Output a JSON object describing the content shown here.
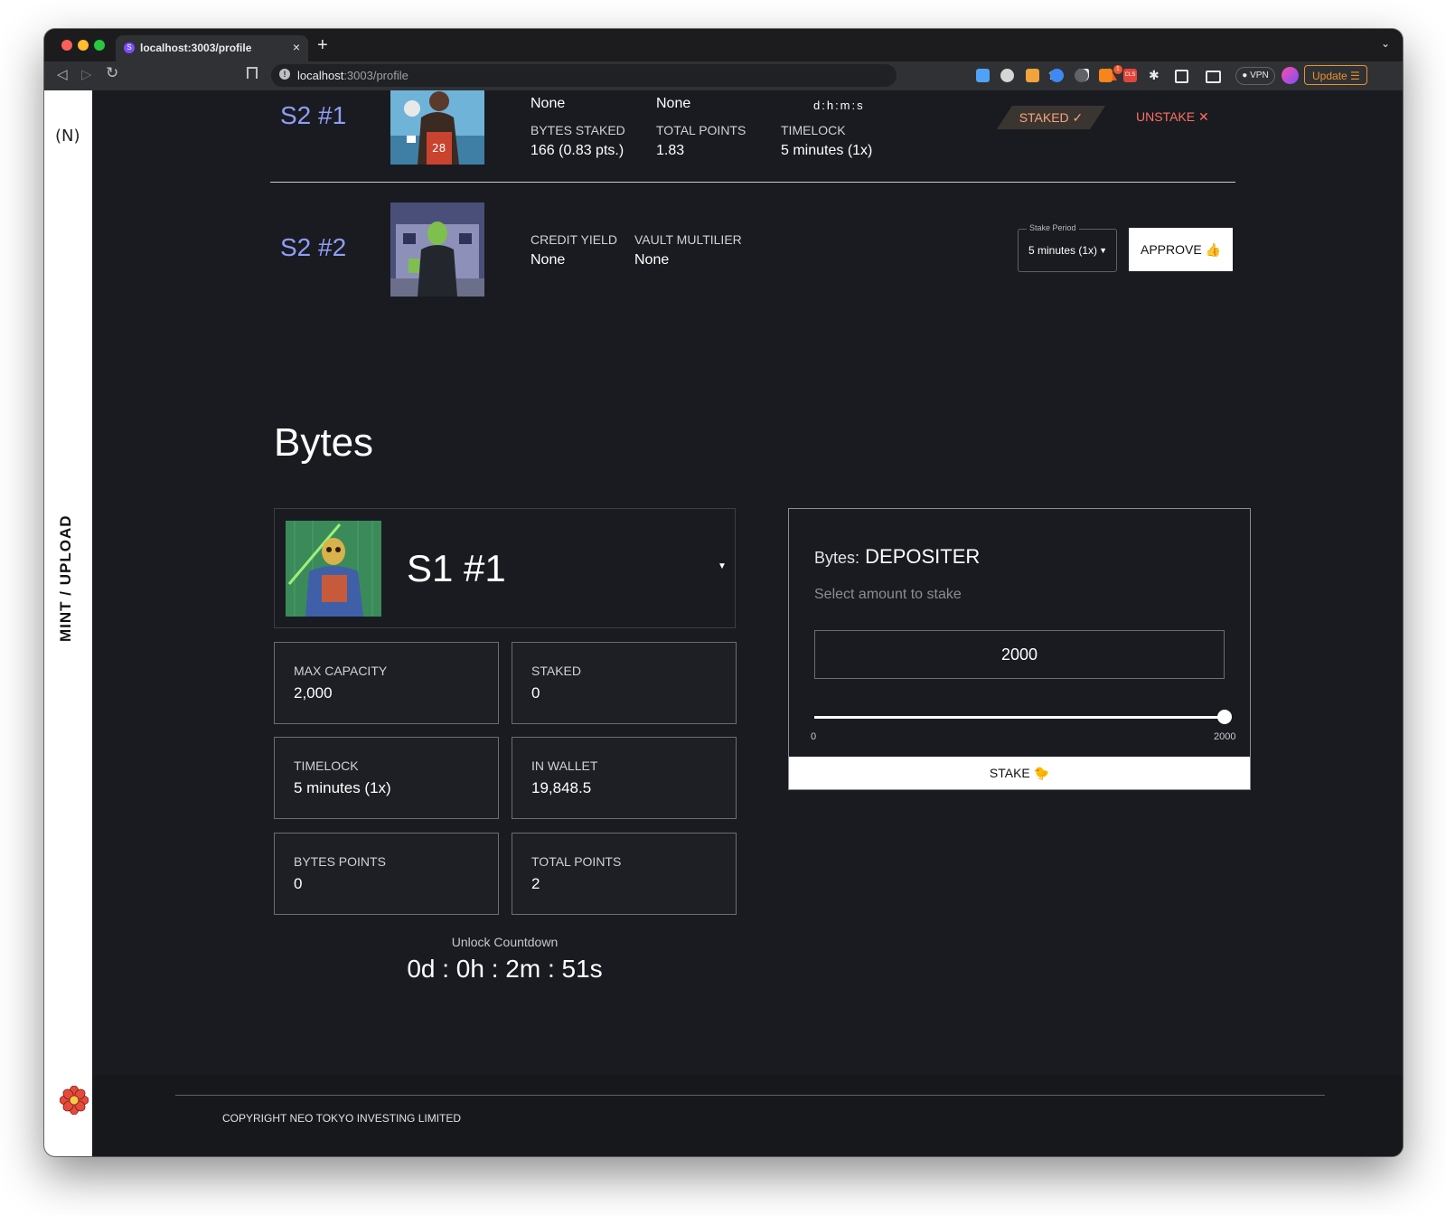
{
  "browser": {
    "tab_title": "localhost:3003/profile",
    "tab_close": "×",
    "new_tab": "+",
    "url_host": "localhost",
    "url_path": ":3003/profile",
    "vpn_label": "● VPN",
    "update_label": "Update ☰",
    "rewards_count": "1"
  },
  "sidebar": {
    "logo": "(N)",
    "mint_label": "MINT / UPLOAD"
  },
  "citizens": [
    {
      "name": "S2 #1",
      "top_values": [
        "None",
        "None"
      ],
      "countdown_format": "d:h:m:s",
      "labels": [
        "BYTES STAKED",
        "TOTAL POINTS",
        "TIMELOCK"
      ],
      "values": [
        "166 (0.83 pts.)",
        "1.83",
        "5 minutes (1x)"
      ],
      "status": "STAKED ✓",
      "unstake": "UNSTAKE ✕"
    },
    {
      "name": "S2 #2",
      "labels": [
        "CREDIT YIELD",
        "VAULT MULTILIER"
      ],
      "values": [
        "None",
        "None"
      ],
      "stake_period_label": "Stake Period",
      "stake_period_value": "5 minutes (1x)",
      "approve": "APPROVE"
    }
  ],
  "bytes": {
    "heading": "Bytes",
    "selected": "S1 #1",
    "stats": [
      {
        "label": "MAX CAPACITY",
        "value": "2,000"
      },
      {
        "label": "STAKED",
        "value": "0"
      },
      {
        "label": "TIMELOCK",
        "value": "5 minutes (1x)"
      },
      {
        "label": "IN WALLET",
        "value": "19,848.5"
      },
      {
        "label": "BYTES POINTS",
        "value": "0"
      },
      {
        "label": "TOTAL POINTS",
        "value": "2"
      }
    ],
    "unlock_label": "Unlock Countdown",
    "unlock_timer": "0d : 0h : 2m : 51s"
  },
  "depositer": {
    "prefix": "Bytes:",
    "title": "DEPOSITER",
    "subtitle": "Select amount to stake",
    "amount": "2000",
    "slider_min": "0",
    "slider_max": "2000",
    "slider_fraction": 1.0,
    "stake_label": "STAKE"
  },
  "footer": {
    "copyright": "COPYRIGHT NEO TOKYO INVESTING LIMITED"
  }
}
